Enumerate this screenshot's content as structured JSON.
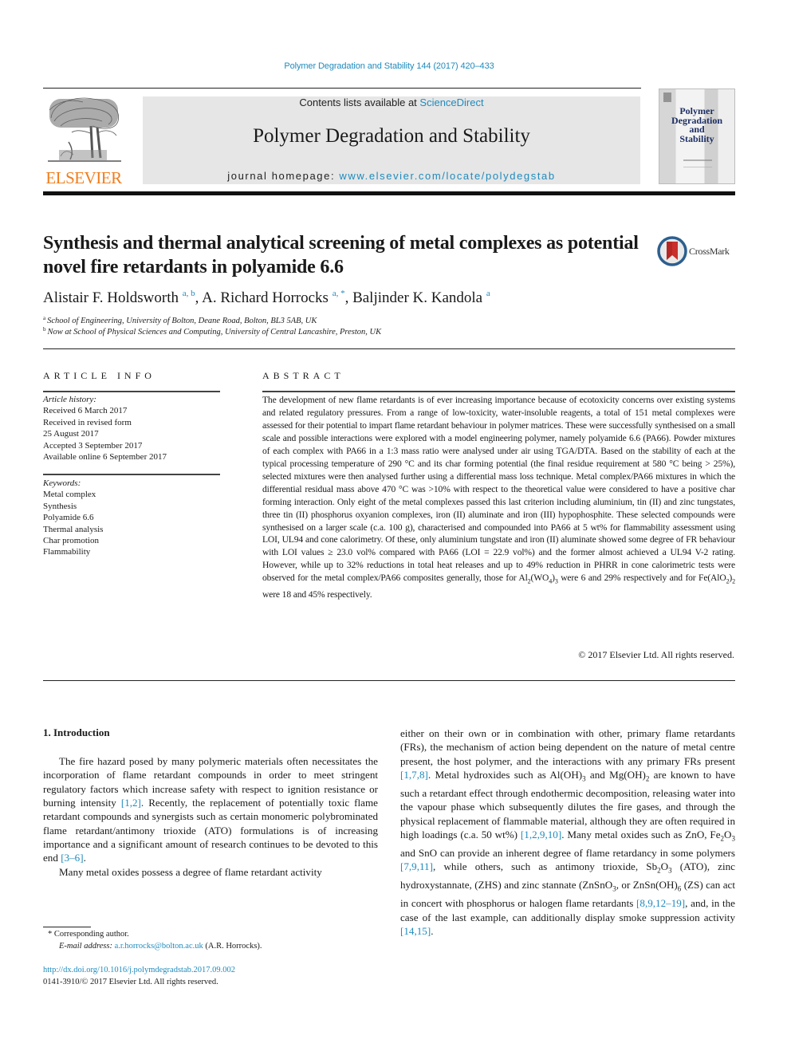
{
  "citation": "Polymer Degradation and Stability 144 (2017) 420–433",
  "masthead": {
    "contents_prefix": "Contents lists available at ",
    "contents_link": "ScienceDirect",
    "journal_title": "Polymer Degradation and Stability",
    "homepage_prefix": "journal homepage: ",
    "homepage_link": "www.elsevier.com/locate/polydegstab",
    "publisher": "ELSEVIER",
    "cover_title_lines": [
      "Polymer",
      "Degradation",
      "and",
      "Stability"
    ]
  },
  "crossmark_label": "CrossMark",
  "article": {
    "title": "Synthesis and thermal analytical screening of metal complexes as potential novel fire retardants in polyamide 6.6",
    "authors": [
      {
        "name": "Alistair F. Holdsworth",
        "marks": "a, b"
      },
      {
        "name": "A. Richard Horrocks",
        "marks": "a, *"
      },
      {
        "name": "Baljinder K. Kandola",
        "marks": "a"
      }
    ],
    "affiliations": [
      {
        "mark": "a",
        "text": "School of Engineering, University of Bolton, Deane Road, Bolton, BL3 5AB, UK"
      },
      {
        "mark": "b",
        "text": "Now at School of Physical Sciences and Computing, University of Central Lancashire, Preston, UK"
      }
    ]
  },
  "article_info": {
    "heading": "ARTICLE INFO",
    "history_label": "Article history:",
    "history": [
      "Received 6 March 2017",
      "Received in revised form",
      "25 August 2017",
      "Accepted 3 September 2017",
      "Available online 6 September 2017"
    ],
    "keywords_label": "Keywords:",
    "keywords": [
      "Metal complex",
      "Synthesis",
      "Polyamide 6.6",
      "Thermal analysis",
      "Char promotion",
      "Flammability"
    ]
  },
  "abstract": {
    "heading": "ABSTRACT",
    "text_1": "The development of new flame retardants is of ever increasing importance because of ecotoxicity concerns over existing systems and related regulatory pressures. From a range of low-toxicity, water-insoluble reagents, a total of 151 metal complexes were assessed for their potential to impart flame retardant behaviour in polymer matrices. These were successfully synthesised on a small scale and possible interactions were explored with a model engineering polymer, namely polyamide 6.6 (PA66). Powder mixtures of each complex with PA66 in a 1:3 mass ratio were analysed under air using TGA/DTA. Based on the stability of each at the typical processing temperature of 290 °C and its char forming potential (the final residue requirement at 580 °C being > 25%), selected mixtures were then analysed further using a differential mass loss technique. Metal complex/PA66 mixtures in which the differential residual mass above 470 °C was >10% with respect to the theoretical value were considered to have a positive char forming interaction. Only eight of the metal complexes passed this last criterion including aluminium, tin (II) and zinc tungstates, three tin (II) phosphorus oxyanion complexes, iron (II) aluminate and iron (III) hypophosphite. These selected compounds were synthesised on a larger scale (c.a. 100 g), characterised and compounded into PA66 at 5 wt% for flammability assessment using LOI, UL94 and cone calorimetry. Of these, only aluminium tungstate and iron (II) aluminate showed some degree of FR behaviour with LOI values ≥ 23.0 vol% compared with PA66 (LOI = 22.9 vol%) and the former almost achieved a UL94 V-2 rating. However, while up to 32% reductions in total heat releases and up to 49% reduction in PHRR in cone calorimetric tests were observed for the metal complex/PA66 composites generally, those for Al",
    "sub_1": "2",
    "text_2": "(WO",
    "sub_2": "4",
    "text_3": ")",
    "sub_3": "3",
    "text_4": " were 6 and 29% respectively and for Fe(AlO",
    "sub_4": "2",
    "text_5": ")",
    "sub_5": "2",
    "text_6": " were 18 and 45% respectively.",
    "copyright": "© 2017 Elsevier Ltd. All rights reserved."
  },
  "introduction": {
    "heading": "1.  Introduction",
    "p1_a": "The fire hazard posed by many polymeric materials often necessitates the incorporation of flame retardant compounds in order to meet stringent regulatory factors which increase safety with respect to ignition resistance or burning intensity ",
    "ref_1": "[1,2]",
    "p1_b": ". Recently, the replacement of potentially toxic flame retardant compounds and synergists such as certain monomeric polybrominated flame retardant/antimony trioxide (ATO) formulations is of increasing importance and a significant amount of research continues to be devoted to this end ",
    "ref_2": "[3–6]",
    "p1_c": ".",
    "p2_a": "Many metal oxides possess a degree of flame retardant activity either on their own or in combination with other, primary flame retardants (FRs), the mechanism of action being dependent on the nature of metal centre present, the host polymer, and the interactions with any primary FRs present ",
    "ref_3": "[1,7,8]",
    "p2_b": ". Metal hydroxides such as Al(OH)",
    "p2_sub1": "3",
    "p2_c": " and Mg(OH)",
    "p2_sub2": "2",
    "p2_d": " are known to have such a retardant effect through endothermic decomposition, releasing water into the vapour phase which subsequently dilutes the fire gases, and through the physical replacement of flammable material, although they are often required in high loadings (c.a. 50 wt%) ",
    "ref_4": "[1,2,9,10]",
    "p2_e": ". Many metal oxides such as ZnO, Fe",
    "p2_sub3": "2",
    "p2_f": "O",
    "p2_sub4": "3",
    "p2_g": " and SnO can provide an inherent degree of flame retardancy in some polymers ",
    "ref_5": "[7,9,11]",
    "p2_h": ", while others, such as antimony trioxide, Sb",
    "p2_sub5": "2",
    "p2_i": "O",
    "p2_sub6": "3",
    "p2_j": " (ATO), zinc hydroxystannate, (ZHS) and zinc stannate (ZnSnO",
    "p2_sub7": "3",
    "p2_k": ", or ZnSn(OH)",
    "p2_sub8": "6",
    "p2_l": " (ZS) can act in concert with phosphorus or halogen flame retardants ",
    "ref_6": "[8,9,12–19]",
    "p2_m": ", and, in the case of the last example, can additionally display smoke suppression activity ",
    "ref_7": "[14,15]",
    "p2_n": "."
  },
  "footnotes": {
    "corresponding": "* Corresponding author.",
    "email_label": "E-mail address: ",
    "email": "a.r.horrocks@bolton.ac.uk",
    "email_suffix": " (A.R. Horrocks).",
    "doi": "http://dx.doi.org/10.1016/j.polymdegradstab.2017.09.002",
    "issn": "0141-3910/© 2017 Elsevier Ltd. All rights reserved."
  },
  "colors": {
    "link": "#1f8bbd",
    "elsevier_orange": "#f07d1b",
    "banner_bg": "#e6e6e6",
    "cover_title": "#1c2e63"
  }
}
